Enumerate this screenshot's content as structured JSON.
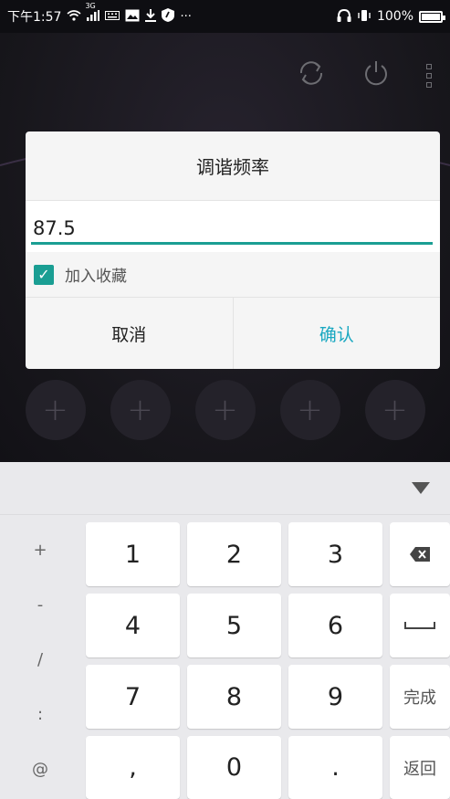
{
  "status_bar": {
    "time": "下午1:57",
    "signal_label": "3G",
    "battery": "100%"
  },
  "dialog": {
    "title": "调谐频率",
    "frequency_value": "87.5",
    "favorite_label": "加入收藏",
    "favorite_checked": true,
    "cancel_label": "取消",
    "confirm_label": "确认"
  },
  "presets": [
    "+",
    "+",
    "+",
    "+",
    "+"
  ],
  "keyboard": {
    "side_keys": [
      "+",
      "-",
      "/",
      ":",
      "@"
    ],
    "row1": [
      "1",
      "2",
      "3"
    ],
    "row2": [
      "4",
      "5",
      "6"
    ],
    "row3": [
      "7",
      "8",
      "9"
    ],
    "row4": [
      ",",
      "0",
      "."
    ],
    "done_label": "完成",
    "back_label": "返回"
  },
  "colors": {
    "accent": "#1a9e93",
    "confirm": "#1aa8c1"
  }
}
